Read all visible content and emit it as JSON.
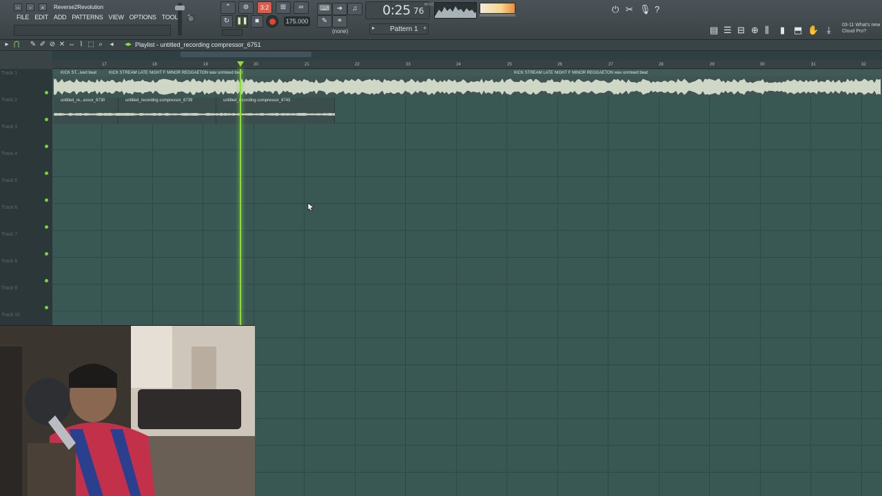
{
  "window": {
    "title": "Reverse2Revolution"
  },
  "menu": [
    "FILE",
    "EDIT",
    "ADD",
    "PATTERNS",
    "VIEW",
    "OPTIONS",
    "TOOLS",
    "?"
  ],
  "transport": {
    "song_pos_badge": "3:2",
    "tempo": "175.000",
    "time_main": "0:25",
    "time_sub": "76",
    "time_unit": "M:S:CS",
    "snap": "(none)",
    "pattern": "Pattern 1"
  },
  "news": {
    "line1_date": "03-11",
    "line1_text": "What's new",
    "line2_text": "Cloud Pro?"
  },
  "playlist": {
    "title": "Playlist - untitled_recording compressor_6751",
    "ruler": [
      "17",
      "18",
      "19",
      "20",
      "21",
      "22",
      "23",
      "24",
      "25",
      "26",
      "27",
      "28",
      "29",
      "30",
      "31",
      "32"
    ],
    "tracks": [
      "Track 1",
      "Track 2",
      "Track 3",
      "Track 4",
      "Track 5",
      "Track 6",
      "Track 7",
      "Track 8",
      "Track 9",
      "Track 10"
    ],
    "clips_track1": [
      {
        "label": "KICK ST...ixed beat"
      },
      {
        "label": "KICK STREAM LATE NIGHT F MINOR REGGAETON wav unmixed beat"
      },
      {
        "label": "KICK STREAM LATE NIGHT F MINOR REGGAETON wav unmixed beat"
      }
    ],
    "clips_track2": [
      {
        "label": "untitled_re...essor_6730"
      },
      {
        "label": "untitled_recording compressor_6739"
      },
      {
        "label": "untitled_recording compressor_6743"
      }
    ]
  },
  "colors": {
    "grid_bg": "#3a5853",
    "playhead": "#88dd3a",
    "record": "#e4452f",
    "meter": "#f5d78a"
  }
}
